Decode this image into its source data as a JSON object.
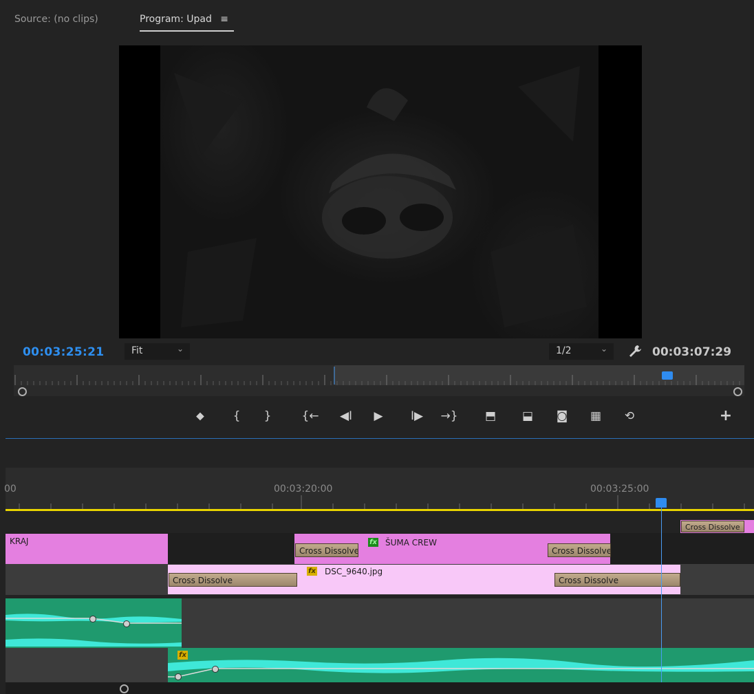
{
  "tabs": {
    "source": "Source: (no clips)",
    "program": "Program: Upad",
    "menu_icon": "≡"
  },
  "monitor": {
    "current_time": "00:03:25:21",
    "zoom": "Fit",
    "resolution": "1/2",
    "duration": "00:03:07:29"
  },
  "controls": {
    "marker": "⬥",
    "mark_in": "{",
    "mark_out": "}",
    "go_to_in": "{←",
    "step_back": "◀I",
    "play": "▶",
    "step_forward": "I▶",
    "go_to_out": "→}",
    "lift": "⬒",
    "extract": "⬓",
    "export_frame": "◙",
    "insert": "▦",
    "overwrite": "⟲",
    "add": "+"
  },
  "timeline": {
    "ruler_labels": [
      "00",
      "00:03:20:00",
      "00:03:25:00"
    ],
    "clips": {
      "kraj": "KRAJ",
      "suma": "ŠUMA CREW",
      "dsc": "DSC_9640.jpg"
    },
    "transitions": {
      "top_right": "Cross Dissolve",
      "v2_a": "Cross Dissolve",
      "v2_b": "Cross Dissolve",
      "v1_a": "Cross Dissolve",
      "v1_b": "Cross Dissolve"
    },
    "fx_label": "fx"
  },
  "colors": {
    "accent_blue": "#2e8ff0",
    "clip_pink": "#e47fe0",
    "clip_light_pink": "#f8c8f8",
    "audio_green": "#1f9a6e",
    "wave_cyan": "#3fe8d8",
    "playhead_yellow": "#e8d400"
  }
}
